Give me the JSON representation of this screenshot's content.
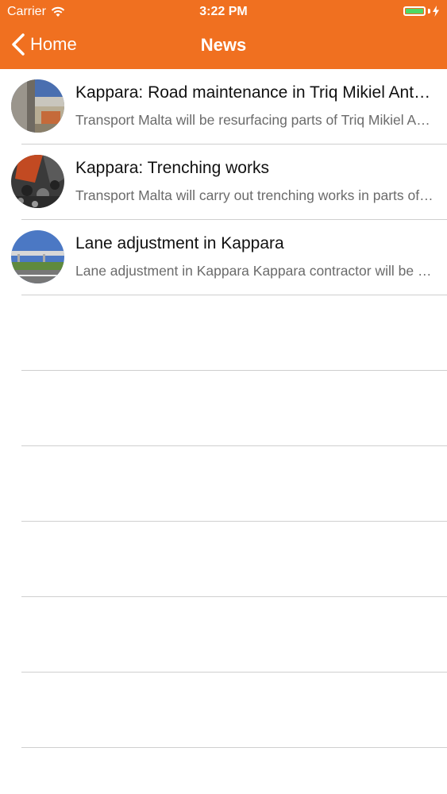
{
  "status_bar": {
    "carrier": "Carrier",
    "time": "3:22 PM",
    "battery_color": "#4cd964"
  },
  "nav": {
    "back_label": "Home",
    "title": "News",
    "background": "#f07020"
  },
  "news": [
    {
      "title": "Kappara: Road maintenance in Triq Mikiel Anton Vassalli",
      "subtitle": "Transport Malta will be resurfacing parts of Triq Mikiel Anton Vassalli",
      "thumbnail": "road-maintenance-photo"
    },
    {
      "title": "Kappara: Trenching works",
      "subtitle": "Transport Malta will carry out trenching works in parts of Kappara",
      "thumbnail": "trenching-works-photo"
    },
    {
      "title": "Lane adjustment in Kappara",
      "subtitle": "Lane adjustment in Kappara Kappara contractor will be carrying out works",
      "thumbnail": "lane-adjustment-photo"
    }
  ]
}
